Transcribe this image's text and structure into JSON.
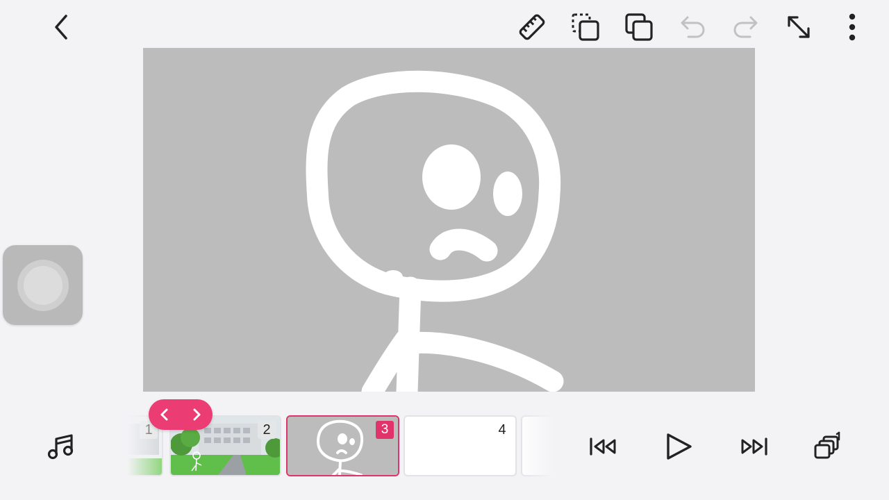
{
  "frames": [
    {
      "number": "1"
    },
    {
      "number": "2"
    },
    {
      "number": "3",
      "selected": true
    },
    {
      "number": "4"
    }
  ],
  "colors": {
    "accent": "#e1336b",
    "canvas_background": "#bcbcbc",
    "stroke": "#ffffff"
  },
  "toolbar": {
    "icons": [
      "back-icon",
      "ruler-icon",
      "copy-selection-icon",
      "duplicate-icon",
      "undo-icon",
      "redo-icon",
      "fullscreen-icon",
      "more-options-icon"
    ],
    "undo_enabled": false,
    "redo_enabled": false
  },
  "bottom_bar": {
    "icons": [
      "music-icon",
      "skip-to-start-icon",
      "play-icon",
      "skip-to-end-icon",
      "layers-icon"
    ]
  }
}
